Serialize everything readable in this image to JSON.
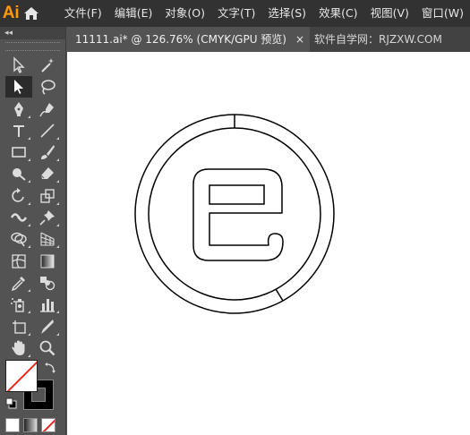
{
  "app": {
    "logo": "Ai"
  },
  "menu": [
    "文件(F)",
    "编辑(E)",
    "对象(O)",
    "文字(T)",
    "选择(S)",
    "效果(C)",
    "视图(V)",
    "窗口(W)"
  ],
  "panel": {
    "collapse_label": "◂◂"
  },
  "document": {
    "tab_label": "11111.ai* @ 126.76% (CMYK/GPU 预览)",
    "close_label": "×",
    "watermark": "软件自学网：RJZXW.COM"
  },
  "tools": [
    "selection-tool",
    "magic-wand-tool",
    "direct-selection-tool",
    "lasso-tool",
    "pen-tool",
    "curvature-tool",
    "type-tool",
    "line-segment-tool",
    "rectangle-tool",
    "paintbrush-tool",
    "shaper-tool",
    "eraser-tool",
    "rotate-tool",
    "scale-tool",
    "width-tool",
    "puppet-warp-tool",
    "shape-builder-tool",
    "perspective-grid-tool",
    "mesh-tool",
    "gradient-tool",
    "eyedropper-tool",
    "blend-tool",
    "symbol-sprayer-tool",
    "column-graph-tool",
    "artboard-tool",
    "slice-tool",
    "hand-tool",
    "zoom-tool"
  ],
  "colors": {
    "fill": "#ffffff",
    "stroke": "#000000",
    "accent": "#ff9a00"
  }
}
